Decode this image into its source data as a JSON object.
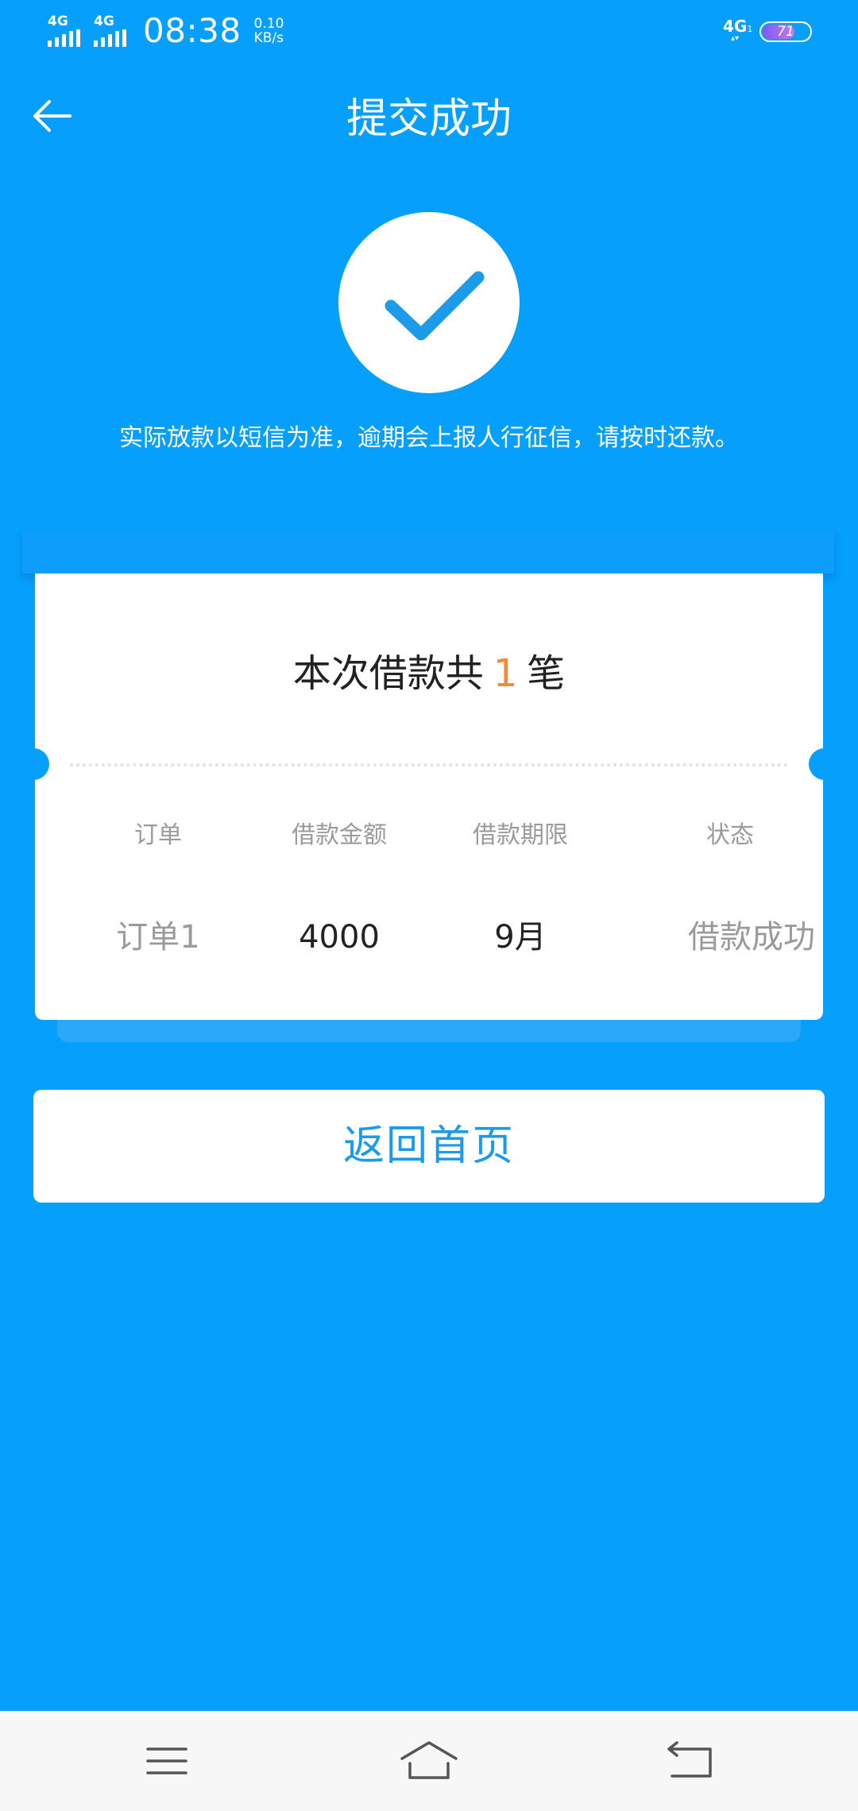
{
  "status_bar": {
    "sim1_tag": "4G",
    "sim2_tag": "4G",
    "time": "08:38",
    "speed_value": "0.10",
    "speed_unit": "KB/s",
    "network_tag": "4G",
    "network_sub": "1",
    "battery_level": "71",
    "battery_fill_fraction": 0.71,
    "battery_gradient": [
      "#7b5cf2",
      "#c779e6"
    ]
  },
  "header": {
    "title": "提交成功",
    "back_icon": "arrow-left-icon"
  },
  "success": {
    "icon": "checkmark-icon",
    "notice": "实际放款以短信为准，逾期会上报人行征信，请按时还款。"
  },
  "ticket": {
    "summary_prefix": "本次借款共",
    "summary_count": "1",
    "summary_suffix": "笔",
    "columns": [
      "订单",
      "借款金额",
      "借款期限",
      "状态"
    ],
    "row": {
      "order": "订单1",
      "amount": "4000",
      "term": "9月",
      "status": "借款成功"
    }
  },
  "actions": {
    "home_label": "返回首页"
  },
  "nav_bar": {
    "menu_icon": "menu-icon",
    "home_icon": "home-icon",
    "back_icon": "back-icon"
  },
  "colors": {
    "background": "#069ffb",
    "accent_text": "#1b9be8",
    "count_highlight": "#f08a3c",
    "card": "#ffffff",
    "nav_bar": "#f7f7f7"
  }
}
